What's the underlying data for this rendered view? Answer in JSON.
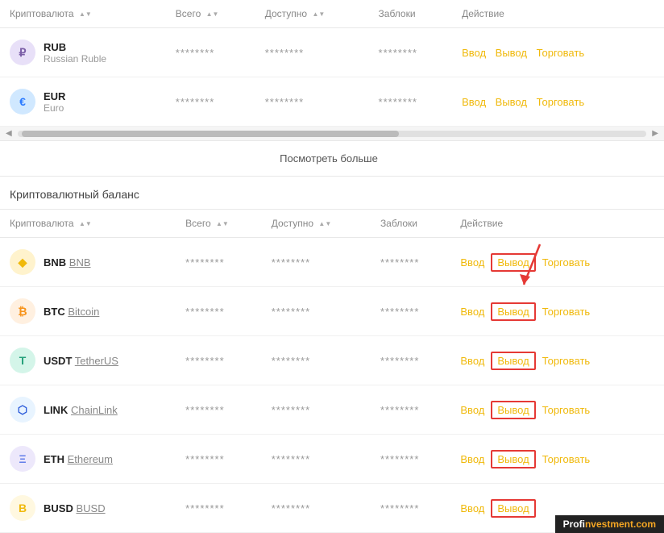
{
  "fiat_section": {
    "columns": [
      {
        "id": "currency",
        "label": "Криптовалюта",
        "sortable": true
      },
      {
        "id": "total",
        "label": "Всего",
        "sortable": true
      },
      {
        "id": "available",
        "label": "Доступно",
        "sortable": true
      },
      {
        "id": "blocked",
        "label": "Заблоки",
        "sortable": false
      },
      {
        "id": "action",
        "label": "Действие",
        "sortable": false
      }
    ],
    "rows": [
      {
        "icon_class": "icon-rub",
        "icon_symbol": "₽",
        "code": "RUB",
        "name": "Russian Ruble",
        "total": "********",
        "available": "********",
        "blocked": "********",
        "actions": [
          "Ввод",
          "Вывод",
          "Торговать"
        ]
      },
      {
        "icon_class": "icon-eur",
        "icon_symbol": "€",
        "code": "EUR",
        "name": "Euro",
        "total": "********",
        "available": "********",
        "blocked": "********",
        "actions": [
          "Ввод",
          "Вывод",
          "Торговать"
        ]
      }
    ],
    "see_more_label": "Посмотреть больше"
  },
  "crypto_section": {
    "title": "Криптовалютный баланс",
    "columns": [
      {
        "id": "currency",
        "label": "Криптовалюта",
        "sortable": true
      },
      {
        "id": "total",
        "label": "Всего",
        "sortable": true
      },
      {
        "id": "available",
        "label": "Доступно",
        "sortable": true
      },
      {
        "id": "blocked",
        "label": "Заблоки",
        "sortable": false
      },
      {
        "id": "action",
        "label": "Действие",
        "sortable": false
      }
    ],
    "rows": [
      {
        "icon_class": "icon-bnb",
        "icon_symbol": "◆",
        "code": "BNB",
        "name": "BNB",
        "name_link": true,
        "total": "********",
        "available": "********",
        "blocked": "********",
        "actions": [
          "Ввод",
          "Вывод",
          "Торговать"
        ],
        "highlight_withdraw": true
      },
      {
        "icon_class": "icon-btc",
        "icon_symbol": "₿",
        "code": "BTC",
        "name": "Bitcoin",
        "name_link": true,
        "total": "********",
        "available": "********",
        "blocked": "********",
        "actions": [
          "Ввод",
          "Вывод",
          "Торговать"
        ],
        "highlight_withdraw": true
      },
      {
        "icon_class": "icon-usdt",
        "icon_symbol": "T",
        "code": "USDT",
        "name": "TetherUS",
        "name_link": true,
        "total": "********",
        "available": "********",
        "blocked": "********",
        "actions": [
          "Ввод",
          "Вывод",
          "Торговать"
        ],
        "highlight_withdraw": true
      },
      {
        "icon_class": "icon-link",
        "icon_symbol": "🔗",
        "code": "LINK",
        "name": "ChainLink",
        "name_link": true,
        "total": "********",
        "available": "********",
        "blocked": "********",
        "actions": [
          "Ввод",
          "Вывод",
          "Торговать"
        ],
        "highlight_withdraw": true
      },
      {
        "icon_class": "icon-eth",
        "icon_symbol": "Ξ",
        "code": "ETH",
        "name": "Ethereum",
        "name_link": true,
        "total": "********",
        "available": "********",
        "blocked": "********",
        "actions": [
          "Ввод",
          "Вывод",
          "Торговать"
        ],
        "highlight_withdraw": true
      },
      {
        "icon_class": "icon-busd",
        "icon_symbol": "B",
        "code": "BUSD",
        "name": "BUSD",
        "name_link": true,
        "total": "********",
        "available": "********",
        "blocked": "********",
        "actions": [
          "Ввод",
          "Вывод"
        ],
        "highlight_withdraw": true
      }
    ]
  },
  "badge": {
    "prefix": "Profi",
    "suffix": "nvestment.com"
  },
  "actions": {
    "deposit": "Ввод",
    "withdraw": "Вывод",
    "trade": "Торговать",
    "see_more": "Посмотреть больше"
  }
}
